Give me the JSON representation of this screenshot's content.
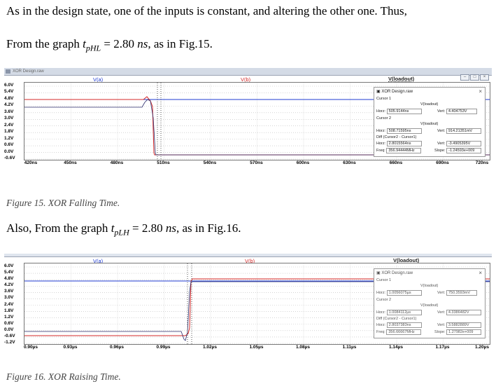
{
  "doc": {
    "para1": "As in the design state, one of the inputs is constant, and altering the other one. Thus,",
    "para2_prefix": "From the graph ",
    "para2_math": "t",
    "para2_sub": "pHL",
    "para2_value": " = 2.80 ",
    "para2_unit": "ns",
    "para2_suffix": ", as in Fig.15.",
    "caption15": "Figure 15. XOR Falling Time.",
    "para3_prefix": "Also, From the graph ",
    "para3_math": "t",
    "para3_sub": "pLH",
    "para3_value": " = 2.80 ",
    "para3_unit": "ns",
    "para3_suffix": ", as in Fig.16.",
    "caption16": "Figure 16. XOR Raising Time."
  },
  "fig15": {
    "window_title": "XOR Design.raw",
    "traces": [
      "V(a)",
      "V(b)",
      "V(loadout)"
    ],
    "y_ticks": [
      "6.0V",
      "5.4V",
      "4.8V",
      "4.2V",
      "3.6V",
      "3.0V",
      "2.4V",
      "1.8V",
      "1.2V",
      "0.6V",
      "0.0V",
      "-0.6V"
    ],
    "x_ticks": [
      "420ns",
      "450ns",
      "480ns",
      "510ns",
      "540ns",
      "570ns",
      "600ns",
      "630ns",
      "660ns",
      "690ns",
      "720ns"
    ],
    "cursor_panel": {
      "title": "XOR Design.raw",
      "cursor1_label": "Cursor 1",
      "cursor1_trace": "V(loadout)",
      "horz_label": "Horz:",
      "vert_label": "Vert:",
      "cursor1_horz": "505.9144ns",
      "cursor1_vert": "4.404753V",
      "cursor2_label": "Cursor 2",
      "cursor2_trace": "V(loadout)",
      "cursor2_horz": "508.71595ns",
      "cursor2_vert": "914.21351mV",
      "diff_label": "Diff (Cursor2 - Cursor1)",
      "diff_horz": "2.8015564ns",
      "diff_vert": "-3.4905395V",
      "freq_label": "Freq:",
      "slope_label": "Slope:",
      "freq": "356.94444MHz",
      "slope": "-1.24593e+009"
    }
  },
  "fig16": {
    "traces": [
      "V(a)",
      "V(b)",
      "V(loadout)"
    ],
    "y_ticks": [
      "6.0V",
      "5.4V",
      "4.8V",
      "4.2V",
      "3.6V",
      "3.0V",
      "2.4V",
      "1.8V",
      "1.2V",
      "0.6V",
      "0.0V",
      "-0.6V",
      "-1.2V"
    ],
    "x_ticks": [
      "0.90µs",
      "0.93µs",
      "0.96µs",
      "0.99µs",
      "1.02µs",
      "1.05µs",
      "1.08µs",
      "1.11µs",
      "1.14µs",
      "1.17µs",
      "1.20µs"
    ],
    "cursor_panel": {
      "title": "XOR Design.raw",
      "cursor1_label": "Cursor 1",
      "cursor1_trace": "V(loadout)",
      "horz_label": "Horz:",
      "vert_label": "Vert:",
      "cursor1_horz": "1.0056075µs",
      "cursor1_vert": "750.3593mV",
      "cursor2_label": "Cursor 2",
      "cursor2_trace": "V(loadout)",
      "cursor2_horz": "1.0084112µs",
      "cursor2_vert": "4.3386482V",
      "diff_label": "Diff (Cursor2 - Cursor1)",
      "diff_horz": "2.8037383ns",
      "diff_vert": "3.5882889V",
      "freq_label": "Freq:",
      "slope_label": "Slope:",
      "freq": "356.66667MHz",
      "slope": "1.27982e+009"
    }
  },
  "colors": {
    "va": "#1f3bd1",
    "vb": "#d42a2a",
    "vloadout": "#2b2b6b"
  }
}
